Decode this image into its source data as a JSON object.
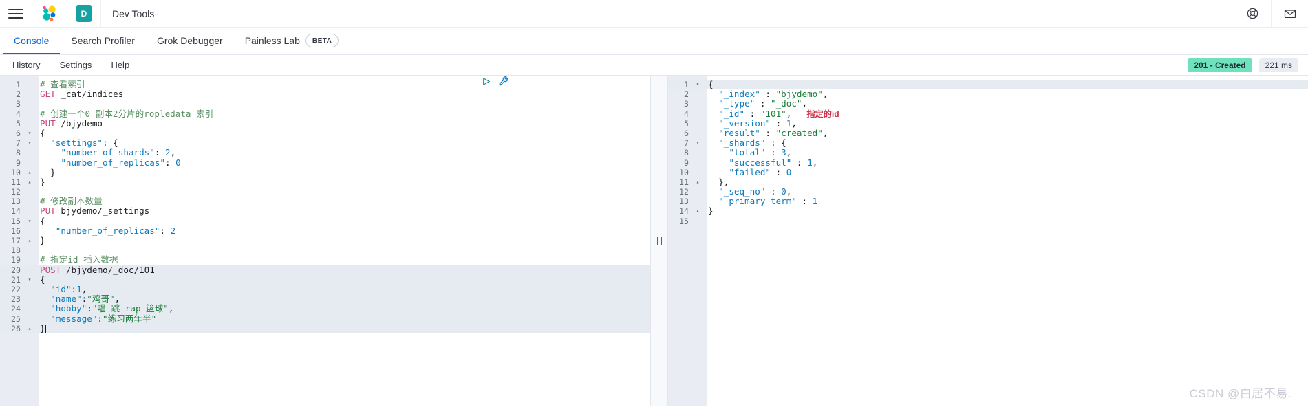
{
  "chrome": {
    "menu_icon": "hamburger-menu-icon",
    "logo_icon": "elastic-logo-icon",
    "space_avatar": "D",
    "app_title": "Dev Tools",
    "help_icon": "lifebuoy-help-icon",
    "news_icon": "mail-newsfeed-icon"
  },
  "tabs": [
    {
      "label": "Console",
      "active": true,
      "badge": ""
    },
    {
      "label": "Search Profiler",
      "active": false,
      "badge": ""
    },
    {
      "label": "Grok Debugger",
      "active": false,
      "badge": ""
    },
    {
      "label": "Painless Lab",
      "active": false,
      "badge": "BETA"
    }
  ],
  "submenu": {
    "items": [
      "History",
      "Settings",
      "Help"
    ],
    "status": "201 - Created",
    "time": "221 ms",
    "status_color": "#6fe2bd"
  },
  "request_editor": {
    "run_icon": "play-run-request-icon",
    "wrench_icon": "wrench-settings-icon",
    "lines": [
      {
        "n": 1,
        "fold": "",
        "hl": false,
        "tokens": [
          {
            "t": "# 查看索引",
            "c": "k-comment"
          }
        ]
      },
      {
        "n": 2,
        "fold": "",
        "hl": false,
        "tokens": [
          {
            "t": "GET",
            "c": "k-method"
          },
          {
            "t": " _cat/indices",
            "c": "k-url"
          }
        ]
      },
      {
        "n": 3,
        "fold": "",
        "hl": false,
        "tokens": []
      },
      {
        "n": 4,
        "fold": "",
        "hl": false,
        "tokens": [
          {
            "t": "# 创建一个0 副本2分片的ropledata 索引",
            "c": "k-comment"
          }
        ]
      },
      {
        "n": 5,
        "fold": "",
        "hl": false,
        "tokens": [
          {
            "t": "PUT",
            "c": "k-method"
          },
          {
            "t": " /bjydemo",
            "c": "k-url"
          }
        ]
      },
      {
        "n": 6,
        "fold": "▾",
        "hl": false,
        "tokens": [
          {
            "t": "{",
            "c": "k-brace"
          }
        ]
      },
      {
        "n": 7,
        "fold": "▾",
        "hl": false,
        "tokens": [
          {
            "t": "  ",
            "c": "k-punct"
          },
          {
            "t": "\"settings\"",
            "c": "k-key"
          },
          {
            "t": ": {",
            "c": "k-punct"
          }
        ]
      },
      {
        "n": 8,
        "fold": "",
        "hl": false,
        "tokens": [
          {
            "t": "    ",
            "c": "k-punct"
          },
          {
            "t": "\"number_of_shards\"",
            "c": "k-key"
          },
          {
            "t": ": ",
            "c": "k-punct"
          },
          {
            "t": "2",
            "c": "k-num"
          },
          {
            "t": ",",
            "c": "k-punct"
          }
        ]
      },
      {
        "n": 9,
        "fold": "",
        "hl": false,
        "tokens": [
          {
            "t": "    ",
            "c": "k-punct"
          },
          {
            "t": "\"number_of_replicas\"",
            "c": "k-key"
          },
          {
            "t": ": ",
            "c": "k-punct"
          },
          {
            "t": "0",
            "c": "k-num"
          }
        ]
      },
      {
        "n": 10,
        "fold": "▴",
        "hl": false,
        "tokens": [
          {
            "t": "  }",
            "c": "k-brace"
          }
        ]
      },
      {
        "n": 11,
        "fold": "▴",
        "hl": false,
        "tokens": [
          {
            "t": "}",
            "c": "k-brace"
          }
        ]
      },
      {
        "n": 12,
        "fold": "",
        "hl": false,
        "tokens": []
      },
      {
        "n": 13,
        "fold": "",
        "hl": false,
        "tokens": [
          {
            "t": "# 修改副本数量",
            "c": "k-comment"
          }
        ]
      },
      {
        "n": 14,
        "fold": "",
        "hl": false,
        "tokens": [
          {
            "t": "PUT",
            "c": "k-method"
          },
          {
            "t": " bjydemo/_settings",
            "c": "k-url"
          }
        ]
      },
      {
        "n": 15,
        "fold": "▾",
        "hl": false,
        "tokens": [
          {
            "t": "{",
            "c": "k-brace"
          }
        ]
      },
      {
        "n": 16,
        "fold": "",
        "hl": false,
        "tokens": [
          {
            "t": "   ",
            "c": "k-punct"
          },
          {
            "t": "\"number_of_replicas\"",
            "c": "k-key"
          },
          {
            "t": ": ",
            "c": "k-punct"
          },
          {
            "t": "2",
            "c": "k-num"
          }
        ]
      },
      {
        "n": 17,
        "fold": "▴",
        "hl": false,
        "tokens": [
          {
            "t": "}",
            "c": "k-brace"
          }
        ]
      },
      {
        "n": 18,
        "fold": "",
        "hl": false,
        "tokens": []
      },
      {
        "n": 19,
        "fold": "",
        "hl": false,
        "tokens": [
          {
            "t": "# 指定id 插入数据",
            "c": "k-comment"
          }
        ]
      },
      {
        "n": 20,
        "fold": "",
        "hl": true,
        "tokens": [
          {
            "t": "POST",
            "c": "k-method"
          },
          {
            "t": " /bjydemo/_doc/101",
            "c": "k-url"
          }
        ]
      },
      {
        "n": 21,
        "fold": "▾",
        "hl": true,
        "tokens": [
          {
            "t": "{",
            "c": "k-brace"
          }
        ]
      },
      {
        "n": 22,
        "fold": "",
        "hl": true,
        "tokens": [
          {
            "t": "  ",
            "c": "k-punct"
          },
          {
            "t": "\"id\"",
            "c": "k-key"
          },
          {
            "t": ":",
            "c": "k-punct"
          },
          {
            "t": "1",
            "c": "k-num"
          },
          {
            "t": ",",
            "c": "k-punct"
          }
        ]
      },
      {
        "n": 23,
        "fold": "",
        "hl": true,
        "tokens": [
          {
            "t": "  ",
            "c": "k-punct"
          },
          {
            "t": "\"name\"",
            "c": "k-key"
          },
          {
            "t": ":",
            "c": "k-punct"
          },
          {
            "t": "\"鸡哥\"",
            "c": "k-str"
          },
          {
            "t": ",",
            "c": "k-punct"
          }
        ]
      },
      {
        "n": 24,
        "fold": "",
        "hl": true,
        "tokens": [
          {
            "t": "  ",
            "c": "k-punct"
          },
          {
            "t": "\"hobby\"",
            "c": "k-key"
          },
          {
            "t": ":",
            "c": "k-punct"
          },
          {
            "t": "\"唱 跳 rap 篮球\"",
            "c": "k-str"
          },
          {
            "t": ",",
            "c": "k-punct"
          }
        ]
      },
      {
        "n": 25,
        "fold": "",
        "hl": true,
        "tokens": [
          {
            "t": "  ",
            "c": "k-punct"
          },
          {
            "t": "\"message\"",
            "c": "k-key"
          },
          {
            "t": ":",
            "c": "k-punct"
          },
          {
            "t": "\"练习两年半\"",
            "c": "k-str"
          }
        ]
      },
      {
        "n": 26,
        "fold": "▴",
        "hl": true,
        "tokens": [
          {
            "t": "}",
            "c": "k-brace"
          }
        ],
        "caret": true
      }
    ]
  },
  "response_editor": {
    "annotation": "指定的id",
    "annotation_color": "#d0344c",
    "lines": [
      {
        "n": 1,
        "fold": "▾",
        "hl": true,
        "tokens": [
          {
            "t": "{",
            "c": "k-brace"
          }
        ]
      },
      {
        "n": 2,
        "fold": "",
        "hl": false,
        "tokens": [
          {
            "t": "  ",
            "c": "k-punct"
          },
          {
            "t": "\"_index\"",
            "c": "k-key"
          },
          {
            "t": " : ",
            "c": "k-punct"
          },
          {
            "t": "\"bjydemo\"",
            "c": "k-str"
          },
          {
            "t": ",",
            "c": "k-punct"
          }
        ]
      },
      {
        "n": 3,
        "fold": "",
        "hl": false,
        "tokens": [
          {
            "t": "  ",
            "c": "k-punct"
          },
          {
            "t": "\"_type\"",
            "c": "k-key"
          },
          {
            "t": " : ",
            "c": "k-punct"
          },
          {
            "t": "\"_doc\"",
            "c": "k-str"
          },
          {
            "t": ",",
            "c": "k-punct"
          }
        ]
      },
      {
        "n": 4,
        "fold": "",
        "hl": false,
        "tokens": [
          {
            "t": "  ",
            "c": "k-punct"
          },
          {
            "t": "\"_id\"",
            "c": "k-key"
          },
          {
            "t": " : ",
            "c": "k-punct"
          },
          {
            "t": "\"101\"",
            "c": "k-str"
          },
          {
            "t": ",",
            "c": "k-punct"
          }
        ],
        "annot": true
      },
      {
        "n": 5,
        "fold": "",
        "hl": false,
        "tokens": [
          {
            "t": "  ",
            "c": "k-punct"
          },
          {
            "t": "\"_version\"",
            "c": "k-key"
          },
          {
            "t": " : ",
            "c": "k-punct"
          },
          {
            "t": "1",
            "c": "k-num"
          },
          {
            "t": ",",
            "c": "k-punct"
          }
        ]
      },
      {
        "n": 6,
        "fold": "",
        "hl": false,
        "tokens": [
          {
            "t": "  ",
            "c": "k-punct"
          },
          {
            "t": "\"result\"",
            "c": "k-key"
          },
          {
            "t": " : ",
            "c": "k-punct"
          },
          {
            "t": "\"created\"",
            "c": "k-str"
          },
          {
            "t": ",",
            "c": "k-punct"
          }
        ]
      },
      {
        "n": 7,
        "fold": "▾",
        "hl": false,
        "tokens": [
          {
            "t": "  ",
            "c": "k-punct"
          },
          {
            "t": "\"_shards\"",
            "c": "k-key"
          },
          {
            "t": " : {",
            "c": "k-punct"
          }
        ]
      },
      {
        "n": 8,
        "fold": "",
        "hl": false,
        "tokens": [
          {
            "t": "    ",
            "c": "k-punct"
          },
          {
            "t": "\"total\"",
            "c": "k-key"
          },
          {
            "t": " : ",
            "c": "k-punct"
          },
          {
            "t": "3",
            "c": "k-num"
          },
          {
            "t": ",",
            "c": "k-punct"
          }
        ]
      },
      {
        "n": 9,
        "fold": "",
        "hl": false,
        "tokens": [
          {
            "t": "    ",
            "c": "k-punct"
          },
          {
            "t": "\"successful\"",
            "c": "k-key"
          },
          {
            "t": " : ",
            "c": "k-punct"
          },
          {
            "t": "1",
            "c": "k-num"
          },
          {
            "t": ",",
            "c": "k-punct"
          }
        ]
      },
      {
        "n": 10,
        "fold": "",
        "hl": false,
        "tokens": [
          {
            "t": "    ",
            "c": "k-punct"
          },
          {
            "t": "\"failed\"",
            "c": "k-key"
          },
          {
            "t": " : ",
            "c": "k-punct"
          },
          {
            "t": "0",
            "c": "k-num"
          }
        ]
      },
      {
        "n": 11,
        "fold": "▴",
        "hl": false,
        "tokens": [
          {
            "t": "  },",
            "c": "k-brace"
          }
        ]
      },
      {
        "n": 12,
        "fold": "",
        "hl": false,
        "tokens": [
          {
            "t": "  ",
            "c": "k-punct"
          },
          {
            "t": "\"_seq_no\"",
            "c": "k-key"
          },
          {
            "t": " : ",
            "c": "k-punct"
          },
          {
            "t": "0",
            "c": "k-num"
          },
          {
            "t": ",",
            "c": "k-punct"
          }
        ]
      },
      {
        "n": 13,
        "fold": "",
        "hl": false,
        "tokens": [
          {
            "t": "  ",
            "c": "k-punct"
          },
          {
            "t": "\"_primary_term\"",
            "c": "k-key"
          },
          {
            "t": " : ",
            "c": "k-punct"
          },
          {
            "t": "1",
            "c": "k-num"
          }
        ]
      },
      {
        "n": 14,
        "fold": "▴",
        "hl": false,
        "tokens": [
          {
            "t": "}",
            "c": "k-brace"
          }
        ]
      },
      {
        "n": 15,
        "fold": "",
        "hl": false,
        "tokens": []
      }
    ]
  },
  "watermark": "CSDN @白居不易."
}
